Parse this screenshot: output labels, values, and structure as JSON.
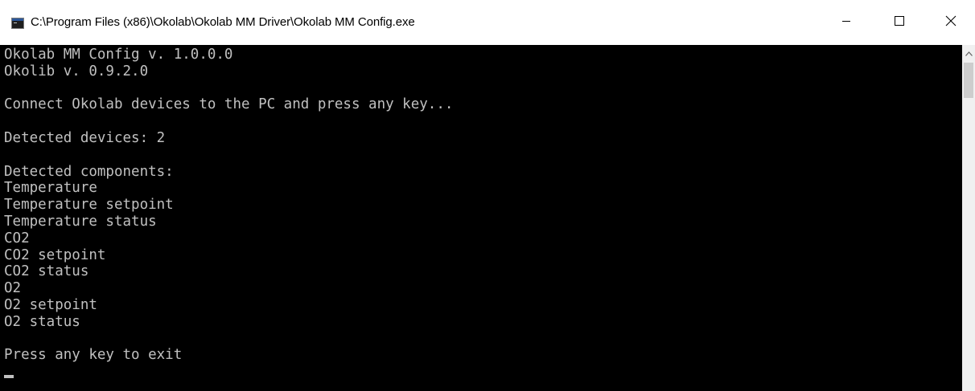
{
  "window": {
    "title": "C:\\Program Files (x86)\\Okolab\\Okolab MM Driver\\Okolab MM Config.exe",
    "app_icon": "console-icon",
    "controls": {
      "minimize_icon": "minimize-icon",
      "maximize_icon": "maximize-icon",
      "close_icon": "close-icon"
    }
  },
  "console": {
    "text_color": "#c0c0c0",
    "background": "#000000",
    "lines": [
      "Okolab MM Config v. 1.0.0.0",
      "Okolib v. 0.9.2.0",
      "",
      "Connect Okolab devices to the PC and press any key...",
      "",
      "Detected devices: 2",
      "",
      "Detected components:",
      "Temperature",
      "Temperature setpoint",
      "Temperature status",
      "CO2",
      "CO2 setpoint",
      "CO2 status",
      "O2",
      "O2 setpoint",
      "O2 status",
      "",
      "Press any key to exit"
    ]
  }
}
